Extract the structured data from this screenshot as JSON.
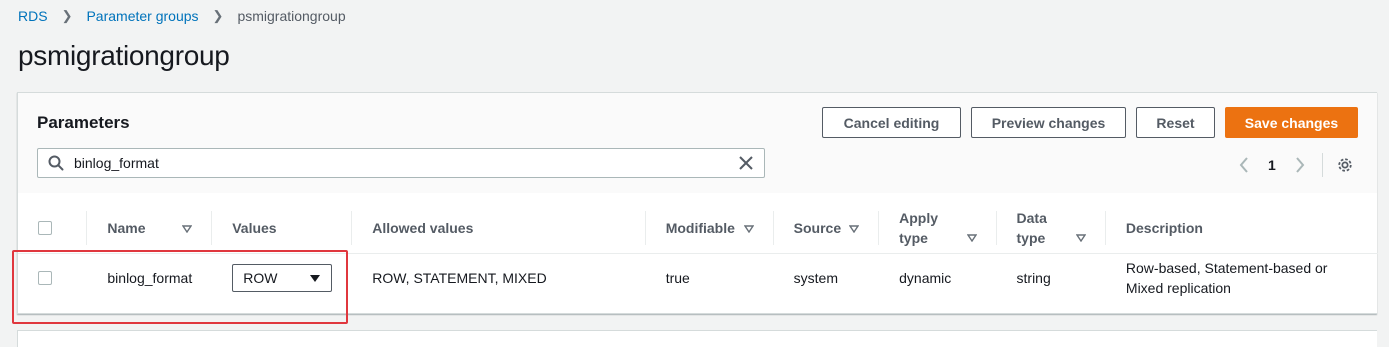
{
  "breadcrumb": {
    "items": [
      "RDS",
      "Parameter groups"
    ],
    "current": "psmigrationgroup"
  },
  "page": {
    "title": "psmigrationgroup"
  },
  "panel": {
    "title": "Parameters",
    "buttons": {
      "cancel": "Cancel editing",
      "preview": "Preview changes",
      "reset": "Reset",
      "save": "Save changes"
    },
    "search": {
      "value": "binlog_format"
    },
    "pager": {
      "page": "1"
    }
  },
  "table": {
    "columns": [
      "Name",
      "Values",
      "Allowed values",
      "Modifiable",
      "Source",
      "Apply type",
      "Data type",
      "Description"
    ],
    "rows": [
      {
        "name": "binlog_format",
        "value": "ROW",
        "allowed": "ROW, STATEMENT, MIXED",
        "modifiable": "true",
        "source": "system",
        "apply_type": "dynamic",
        "data_type": "string",
        "description": "Row-based, Statement-based or Mixed replication"
      }
    ]
  },
  "colors": {
    "primary": "#ec7211",
    "link": "#0073bb",
    "highlight": "#e0373e"
  }
}
